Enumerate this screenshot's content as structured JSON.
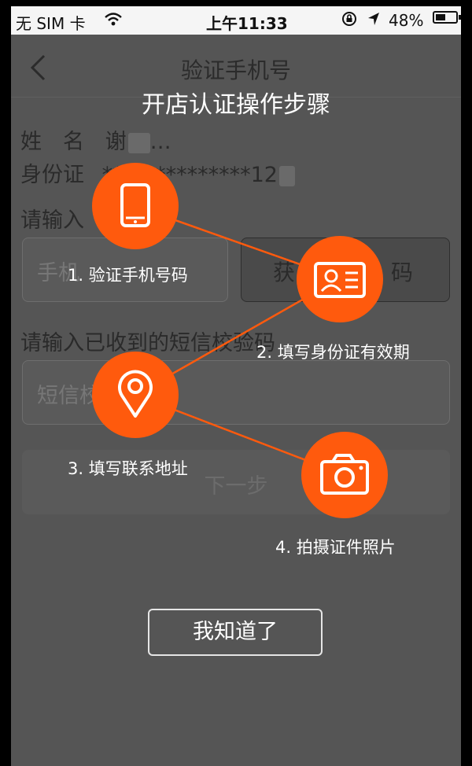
{
  "status_bar": {
    "carrier": "无 SIM 卡",
    "time": "上午11:33",
    "battery": "48%",
    "battery_level": 0.48
  },
  "nav": {
    "title": "验证手机号"
  },
  "form": {
    "name_label": "姓　名",
    "name_value": "谢",
    "name_value_end": "…",
    "id_label": "身份证",
    "id_value": "**************12",
    "phone_prompt": "请输入",
    "phone_placeholder": "手机",
    "get_code_button": "获",
    "get_code_button_end": "码",
    "sms_prompt": "请输入已收到的短信校验码",
    "sms_placeholder": "短信校",
    "next_button": "下一步"
  },
  "overlay": {
    "title": "开店认证操作步骤",
    "accent_color": "#ff5a0d",
    "steps": [
      {
        "label": "1. 验证手机号码",
        "icon": "phone-icon"
      },
      {
        "label": "2. 填写身份证有效期",
        "icon": "id-card-icon"
      },
      {
        "label": "3. 填写联系地址",
        "icon": "location-pin-icon"
      },
      {
        "label": "4. 拍摄证件照片",
        "icon": "camera-icon"
      }
    ],
    "got_it_button": "我知道了"
  }
}
